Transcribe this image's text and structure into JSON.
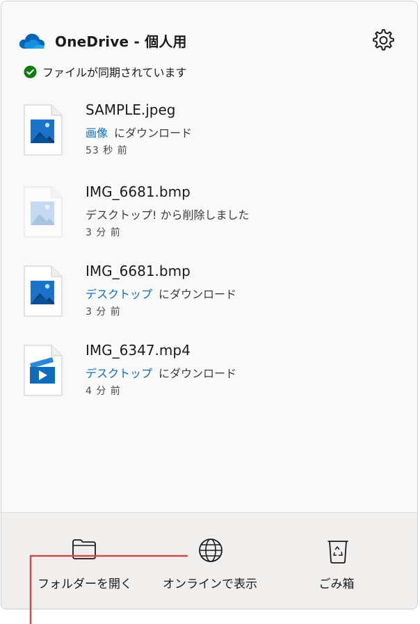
{
  "header": {
    "title": "OneDrive - 個人用",
    "status": "ファイルが同期されています"
  },
  "items": [
    {
      "name": "SAMPLE.jpeg",
      "link": "画像",
      "action": "にダウンロード",
      "time": "53 秒 前",
      "icon": "image-file-icon"
    },
    {
      "name": "IMG_6681.bmp",
      "link": "",
      "action": "デスクトップ! から削除しました",
      "time": "3 分 前",
      "icon": "deleted-image-file-icon"
    },
    {
      "name": "IMG_6681.bmp",
      "link": "デスクトップ",
      "action": "にダウンロード",
      "time": "3 分 前",
      "icon": "image-file-icon"
    },
    {
      "name": "IMG_6347.mp4",
      "link": "デスクトップ",
      "action": "にダウンロード",
      "time": "4 分 前",
      "icon": "video-file-icon"
    }
  ],
  "footer": {
    "open_folder": "フォルダーを開く",
    "view_online": "オンラインで表示",
    "recycle_bin": "ごみ箱"
  },
  "colors": {
    "accent": "#0f6cbd",
    "success": "#107c10",
    "callout": "#d04a4f"
  }
}
